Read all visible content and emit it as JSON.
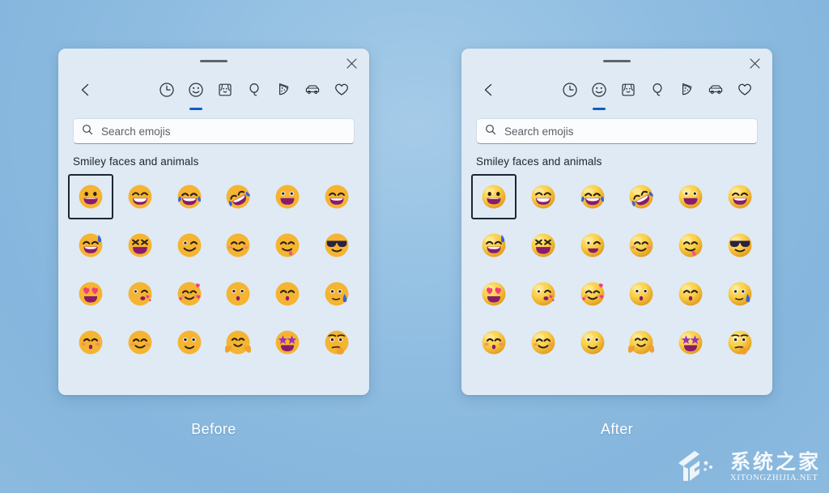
{
  "comparison": {
    "before_label": "Before",
    "after_label": "After"
  },
  "panel": {
    "close_label": "Close",
    "drag_handle_label": "Drag handle",
    "search": {
      "placeholder": "Search emojis",
      "value": ""
    },
    "section_title": "Smiley faces and animals",
    "categories": [
      {
        "name": "back-arrow-icon",
        "label": "Back"
      },
      {
        "name": "clock-icon",
        "label": "Recently used"
      },
      {
        "name": "smiley-icon",
        "label": "Smiley faces and animals",
        "active": true
      },
      {
        "name": "people-icon",
        "label": "People"
      },
      {
        "name": "balloon-icon",
        "label": "Celebration and objects"
      },
      {
        "name": "pizza-icon",
        "label": "Food and plants"
      },
      {
        "name": "car-icon",
        "label": "Transportation and places"
      },
      {
        "name": "heart-icon",
        "label": "Symbols"
      }
    ],
    "emojis": [
      {
        "name": "grinning-face",
        "char": "😀"
      },
      {
        "name": "beaming-face-with-smiling-eyes",
        "char": "😁"
      },
      {
        "name": "face-with-tears-of-joy",
        "char": "😂"
      },
      {
        "name": "rolling-on-the-floor-laughing",
        "char": "🤣"
      },
      {
        "name": "grinning-face-with-big-eyes",
        "char": "😃"
      },
      {
        "name": "grinning-face-with-smiling-eyes",
        "char": "😄"
      },
      {
        "name": "grinning-face-with-sweat",
        "char": "😅"
      },
      {
        "name": "grinning-squinting-face",
        "char": "😆"
      },
      {
        "name": "winking-face",
        "char": "😉"
      },
      {
        "name": "smiling-face-with-smiling-eyes",
        "char": "😊"
      },
      {
        "name": "face-savoring-food",
        "char": "😋"
      },
      {
        "name": "smiling-face-with-sunglasses",
        "char": "😎"
      },
      {
        "name": "smiling-face-with-heart-eyes",
        "char": "😍"
      },
      {
        "name": "face-blowing-a-kiss",
        "char": "😘"
      },
      {
        "name": "smiling-face-with-hearts",
        "char": "🥰"
      },
      {
        "name": "kissing-face",
        "char": "😗"
      },
      {
        "name": "kissing-face-with-smiling-eyes",
        "char": "😙"
      },
      {
        "name": "sleepy-face",
        "char": "😪"
      },
      {
        "name": "kissing-face-with-closed-eyes",
        "char": "😚"
      },
      {
        "name": "slightly-smiling-face",
        "char": "🙂"
      },
      {
        "name": "face-with-open-mouth",
        "char": "😮"
      },
      {
        "name": "hugging-face",
        "char": "🤗"
      },
      {
        "name": "star-struck",
        "char": "🤩"
      },
      {
        "name": "thinking-face",
        "char": "🤔"
      }
    ],
    "selected_index": 0
  },
  "watermark": {
    "cn": "系统之家",
    "en": "XITONGZHIJIA.NET"
  },
  "colors": {
    "background": "#8fbde1",
    "panel": "#dfeaf5",
    "accent": "#0b5ec7",
    "selection_border": "#1b2733",
    "search_background": "#fbfcfe",
    "emoji_yellow": "#f5b431",
    "emoji_mouth": "#8a1a6e"
  }
}
